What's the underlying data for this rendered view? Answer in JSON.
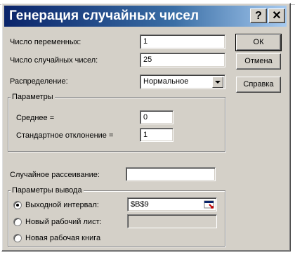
{
  "dialog": {
    "title": "Генерация случайных чисел",
    "help_glyph": "?",
    "close_glyph": "✕"
  },
  "fields": {
    "num_variables_label": "Число переменных:",
    "num_variables_value": "1",
    "num_random_label": "Число случайных чисел:",
    "num_random_value": "25",
    "distribution_label": "Распределение:",
    "distribution_value": "Нормальное",
    "seed_label": "Случайное рассеивание:",
    "seed_value": ""
  },
  "parameters": {
    "group_title": "Параметры",
    "mean_label": "Среднее =",
    "mean_value": "0",
    "stddev_label": "Стандартное отклонение =",
    "stddev_value": "1"
  },
  "output": {
    "group_title": "Параметры вывода",
    "output_range_label": "Выходной интервал:",
    "output_range_value": "$B$9",
    "new_sheet_label": "Новый рабочий лист:",
    "new_sheet_value": "",
    "new_book_label": "Новая рабочая книга",
    "selected": "output_range"
  },
  "buttons": {
    "ok": "ОК",
    "cancel": "Отмена",
    "help": "Справка"
  },
  "icons": {
    "dropdown": "chevron-down-icon",
    "range_picker": "collapse-dialog-icon"
  },
  "colors": {
    "title_start": "#0a246a",
    "title_end": "#a6caf0",
    "face": "#d4d0c8"
  }
}
